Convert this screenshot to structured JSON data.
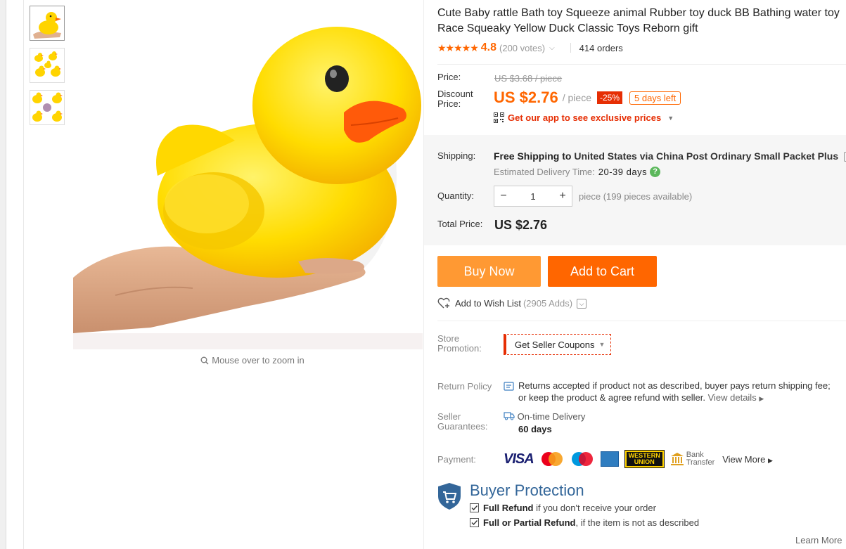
{
  "product": {
    "title": "Cute Baby rattle Bath toy Squeeze animal Rubber toy duck BB Bathing water toy Race Squeaky Yellow Duck Classic Toys Reborn gift",
    "stars": "★★★★★",
    "rating": "4.8",
    "votes": "(200 votes)",
    "orders": "414 orders"
  },
  "gallery": {
    "zoom_hint": "Mouse over to zoom in",
    "thumbnail_count": 3
  },
  "price": {
    "price_label": "Price:",
    "old_price": "US $3.68 / piece",
    "discount_label_1": "Discount",
    "discount_label_2": "Price:",
    "new_price": "US $2.76",
    "unit": "/ piece",
    "discount": "-25%",
    "days_left": "5 days left",
    "app_promo": "Get our app to see exclusive prices"
  },
  "shipping": {
    "label": "Shipping:",
    "free": "Free Shipping to",
    "destination": "United States via China Post Ordinary Small Packet Plus",
    "eta_label": "Estimated Delivery Time:",
    "eta_days": "20-39 days"
  },
  "quantity": {
    "label": "Quantity:",
    "value": "1",
    "available": "piece (199 pieces available)"
  },
  "total": {
    "label": "Total Price:",
    "value": "US $2.76"
  },
  "actions": {
    "buy_now": "Buy Now",
    "add_to_cart": "Add to Cart",
    "wish_list": "Add to Wish List",
    "wish_adds": "(2905 Adds)"
  },
  "store": {
    "label_1": "Store",
    "label_2": "Promotion:",
    "coupon": "Get Seller Coupons"
  },
  "return_policy": {
    "label": "Return Policy",
    "line_1": "Returns accepted if product not as described, buyer pays return shipping fee;",
    "line_2": "or keep the product & agree refund with seller.",
    "view_details": "View details"
  },
  "seller_guarantees": {
    "label_1": "Seller",
    "label_2": "Guarantees:",
    "item": "On-time Delivery",
    "days": "60 days"
  },
  "payment": {
    "label": "Payment:",
    "visa": "VISA",
    "wu_1": "WESTERN",
    "wu_2": "UNION",
    "bank_1": "Bank",
    "bank_2": "Transfer",
    "view_more": "View More"
  },
  "buyer_protection": {
    "title": "Buyer Protection",
    "item_1_bold": "Full Refund",
    "item_1_rest": "if you don't receive your order",
    "item_2_bold": "Full or Partial Refund",
    "item_2_rest": ", if the item is not as described",
    "learn_more": "Learn More"
  },
  "colors": {
    "accent_orange": "#ff6600",
    "buy_now": "#ff9933",
    "discount_red": "#e62e04",
    "protection_blue": "#336699"
  }
}
